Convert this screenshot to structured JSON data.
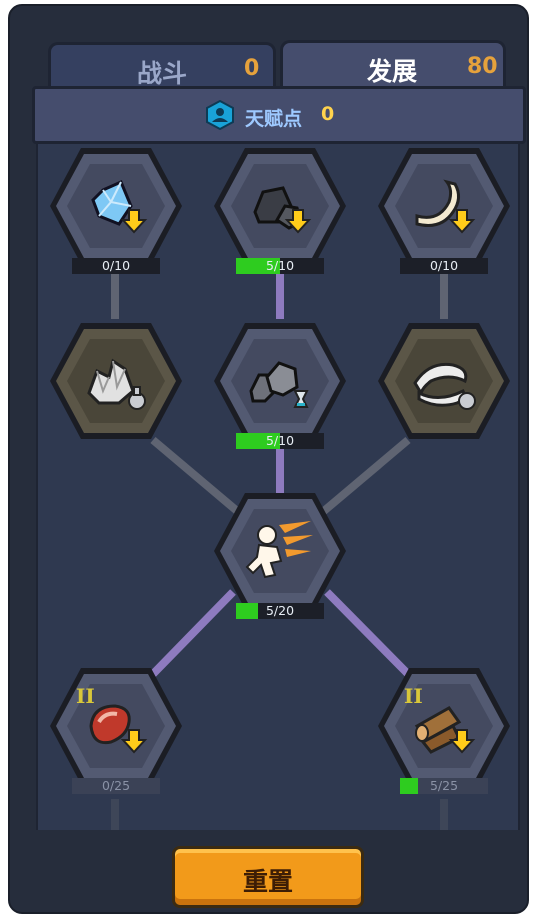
{
  "tabs": [
    {
      "label": "战斗",
      "count": "0",
      "active": false
    },
    {
      "label": "发展",
      "count": "80",
      "active": true
    }
  ],
  "talent_points": {
    "label": "天赋点",
    "value": "0"
  },
  "nodes": [
    {
      "name": "crystal-upgrade",
      "icon": "crystal-icon",
      "progress_text": "0/10",
      "progress": 0,
      "locked": false
    },
    {
      "name": "stone-upgrade",
      "icon": "stone-icon",
      "progress_text": "5/10",
      "progress": 0.5,
      "locked": false
    },
    {
      "name": "bone-upgrade",
      "icon": "bone-icon",
      "progress_text": "0/10",
      "progress": 0,
      "locked": false
    },
    {
      "name": "crystal-pile",
      "icon": "crystal-pile-icon",
      "locked": true
    },
    {
      "name": "stone-pile",
      "icon": "stone-potion-icon",
      "progress_text": "5/10",
      "progress": 0.5,
      "locked": false
    },
    {
      "name": "bone-pile",
      "icon": "bone-pile-icon",
      "locked": true
    },
    {
      "name": "speed-boost",
      "icon": "running-figure-icon",
      "progress_text": "5/20",
      "progress": 0.25,
      "locked": false
    },
    {
      "name": "meat-upgrade",
      "icon": "meat-icon",
      "tier": "II",
      "progress_text": "0/25",
      "progress": 0,
      "locked": false
    },
    {
      "name": "wood-upgrade",
      "icon": "wood-icon",
      "tier": "II",
      "progress_text": "5/25",
      "progress": 0.2,
      "locked": false
    }
  ],
  "reset_button": {
    "label": "重置"
  },
  "colors": {
    "panel": "#262d3c",
    "tree_bg": "#2f3950",
    "accent_orange": "#e6a23c",
    "progress_green": "#2ecc1f",
    "link_active": "#8e7bbf",
    "link_inactive": "#5f6472"
  }
}
